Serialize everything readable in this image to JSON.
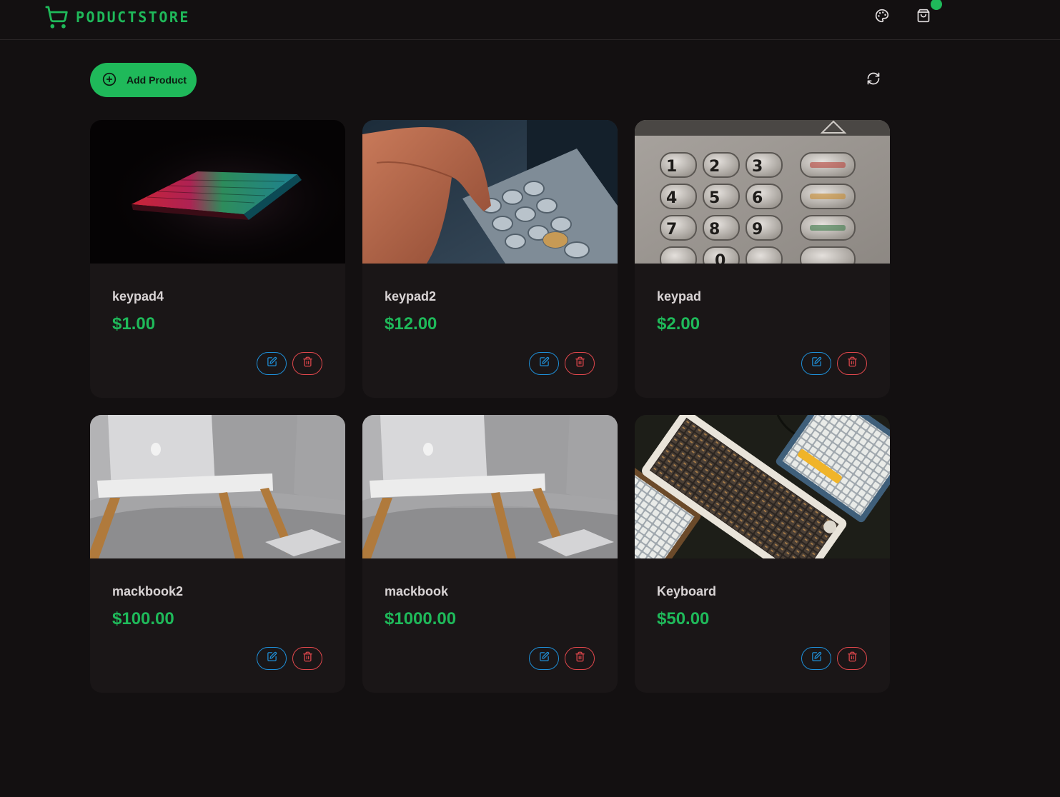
{
  "header": {
    "brand": "PODUCTSTORE",
    "icons": [
      "shopping-cart-icon",
      "palette-icon",
      "shopping-bag-icon"
    ]
  },
  "toolbar": {
    "add_label": "Add Product",
    "icons": [
      "plus-circle-icon",
      "refresh-icon"
    ]
  },
  "colors": {
    "accent": "#1fb95a",
    "background": "#131011",
    "card": "#1a1617",
    "edit": "#1e8fd8",
    "delete": "#e0474c"
  },
  "products": [
    {
      "name": "keypad4",
      "price": "$1.00",
      "image": "laptop-keyboard-rgb-dark"
    },
    {
      "name": "keypad2",
      "price": "$12.00",
      "image": "hand-on-atm-keypad"
    },
    {
      "name": "keypad",
      "price": "$2.00",
      "image": "metal-atm-keypad"
    },
    {
      "name": "mackbook2",
      "price": "$100.00",
      "image": "macbook-on-lap-desk"
    },
    {
      "name": "mackbook",
      "price": "$1000.00",
      "image": "macbook-on-lap-desk"
    },
    {
      "name": "Keyboard",
      "price": "$50.00",
      "image": "mechanical-keyboards"
    }
  ]
}
